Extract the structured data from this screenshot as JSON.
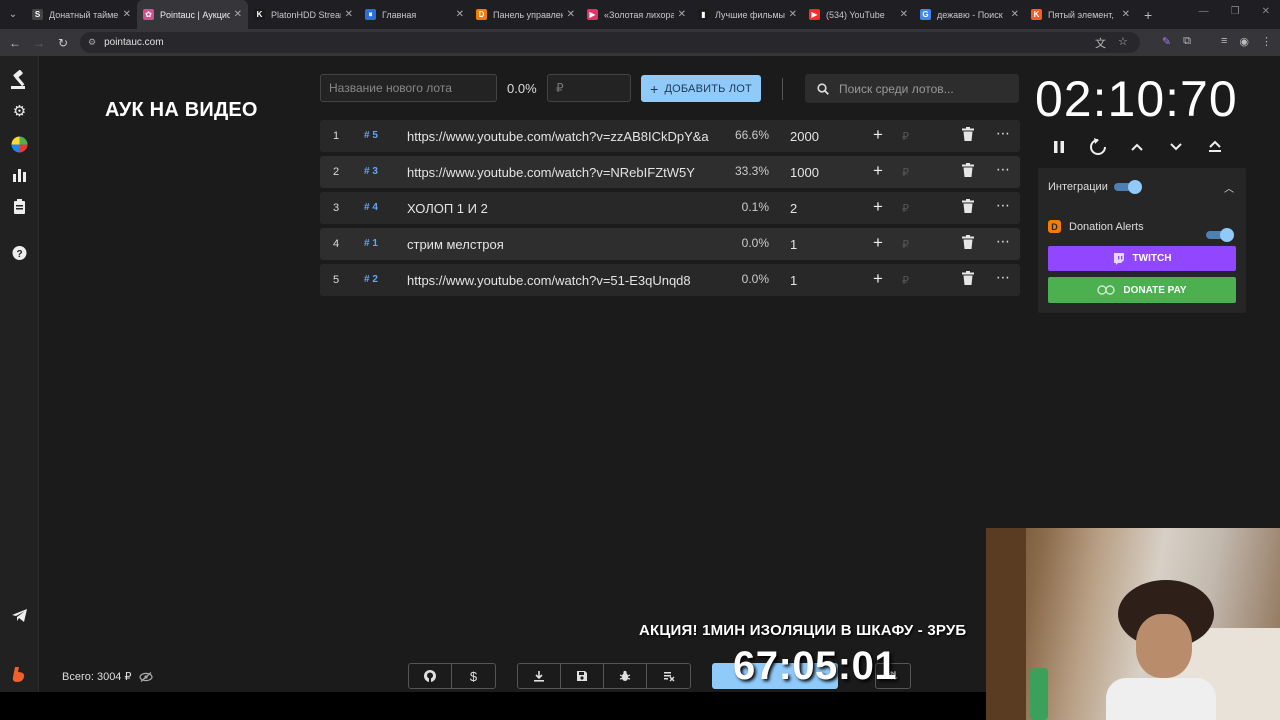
{
  "browser": {
    "tabs": [
      {
        "title": "Донатный таймер",
        "fav": "S",
        "favcolor": "#444444"
      },
      {
        "title": "Pointauc | Аукцион",
        "fav": "✿",
        "favcolor": "#d05090",
        "active": true
      },
      {
        "title": "PlatonHDD Stream",
        "fav": "K",
        "favcolor": "#1a1a1a"
      },
      {
        "title": "Главная",
        "fav": "⏸",
        "favcolor": "#2d6fd8"
      },
      {
        "title": "Панель управления",
        "fav": "D",
        "favcolor": "#f57c00"
      },
      {
        "title": "«Золотая лихорадка»",
        "fav": "▶",
        "favcolor": "#e0336a"
      },
      {
        "title": "Лучшие фильмы",
        "fav": "▮",
        "favcolor": "#1a1a1a"
      },
      {
        "title": "(534) YouTube",
        "fav": "▶",
        "favcolor": "#ff2a2a"
      },
      {
        "title": "дежавю - Поиск",
        "fav": "G",
        "favcolor": "#4285f4"
      },
      {
        "title": "Пятый элемент,",
        "fav": "K",
        "favcolor": "#ff5a1f"
      }
    ],
    "url": "pointauc.com"
  },
  "app": {
    "title": "АУК НА ВИДЕО",
    "new_lot_placeholder": "Название нового лота",
    "new_lot_percent": "0.0%",
    "amount_placeholder": "₽",
    "add_lot_label": "ДОБАВИТЬ ЛОТ",
    "search_placeholder": "Поиск среди лотов...",
    "timer": "02:10:70",
    "total_label": "Всего: 3004 ₽",
    "lots": [
      {
        "num": "1",
        "idx": "# 5",
        "name": "https://www.youtube.com/watch?v=zzAB8ICkDpY&a",
        "percent": "66.6%",
        "amount": "2000"
      },
      {
        "num": "2",
        "idx": "# 3",
        "name": "https://www.youtube.com/watch?v=NRebIFZtW5Y",
        "percent": "33.3%",
        "amount": "1000"
      },
      {
        "num": "3",
        "idx": "# 4",
        "name": "ХОЛОП 1 И 2",
        "percent": "0.1%",
        "amount": "2"
      },
      {
        "num": "4",
        "idx": "# 1",
        "name": "стрим мелстроя",
        "percent": "0.0%",
        "amount": "1"
      },
      {
        "num": "5",
        "idx": "# 2",
        "name": "https://www.youtube.com/watch?v=51-E3qUnqd8",
        "percent": "0.0%",
        "amount": "1"
      }
    ],
    "integrations": {
      "header": "Интеграции",
      "donation_alerts": "Donation Alerts",
      "twitch": "TWITCH",
      "donate_pay": "DONATE PAY"
    }
  },
  "overlay": {
    "promo": "АКЦИЯ! 1МИН ИЗОЛЯЦИИ В ШКАФУ - 3РУБ",
    "big_timer": "67:05:01"
  },
  "colors": {
    "accent": "#90caf9",
    "twitch": "#9147ff",
    "donate_pay": "#4caf50",
    "donation_alerts": "#f57c00"
  }
}
